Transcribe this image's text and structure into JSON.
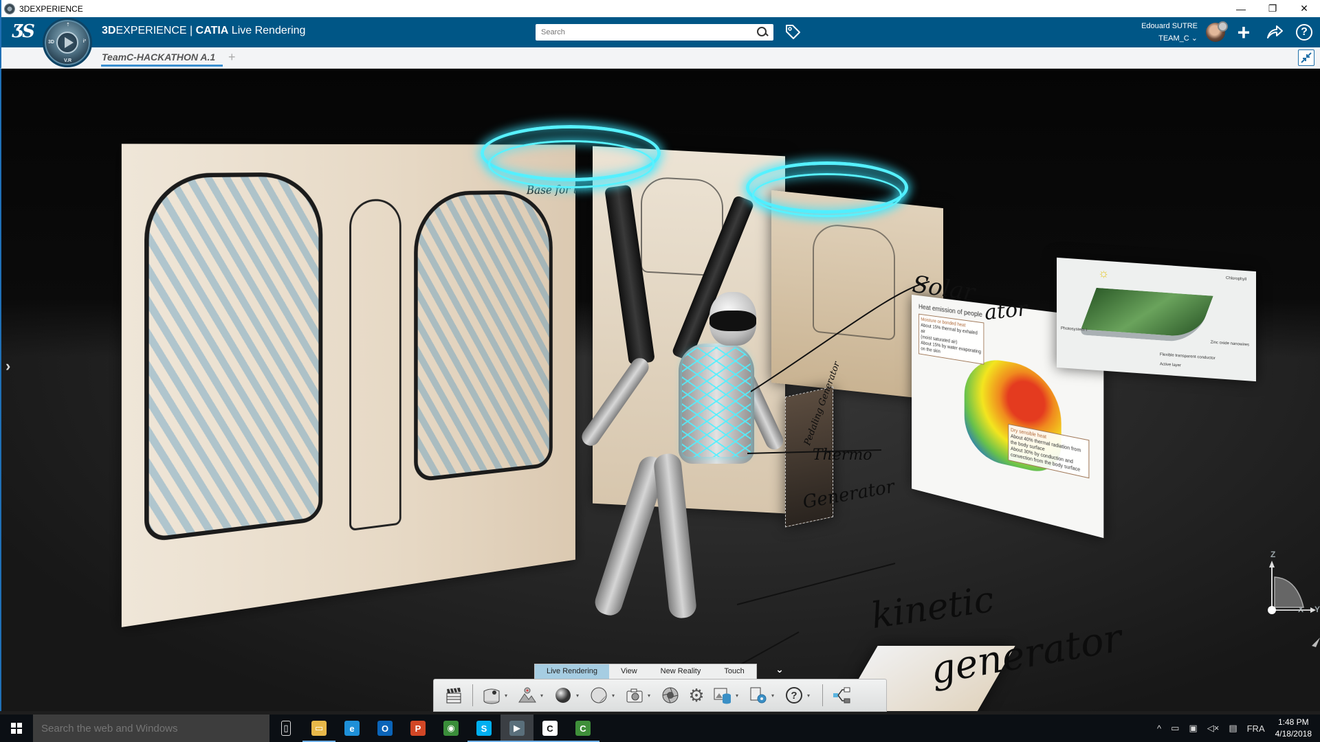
{
  "window": {
    "title": "3DEXPERIENCE",
    "controls": {
      "minimize": "—",
      "restore": "❐",
      "close": "✕"
    }
  },
  "topbar": {
    "brand_bold": "3D",
    "brand_rest": "EXPERIENCE | ",
    "brand_app": "CATIA",
    "brand_suffix": " Live Rendering",
    "search": {
      "placeholder": "Search",
      "value": ""
    },
    "compass_labels": {
      "left": "3D",
      "right": "i³",
      "bottom": "V.R",
      "top": "⇡"
    },
    "user": {
      "name": "Edouard SUTRE",
      "team": "TEAM_C"
    },
    "icons": [
      "ds-logo-icon",
      "compass-icon",
      "search-icon",
      "tag-icon",
      "avatar",
      "plus-icon",
      "share-icon",
      "help-icon"
    ],
    "plus_label": "+",
    "help_label": "?"
  },
  "tabbar": {
    "tabs": [
      {
        "label": "TeamC-HACKATHON A.1",
        "active": true
      }
    ],
    "add_label": "+"
  },
  "viewport": {
    "side_arrow": "›",
    "scene_annotations": {
      "sketch_note": "Base for the Wi",
      "solar": "Solar",
      "solar2": "ator",
      "pedal": "Pedaling Generator",
      "thermo": "Thermo",
      "generator": "Generator",
      "kinetic": "kinetic",
      "kinetic_gen": "generator"
    },
    "heat_panel": {
      "title": "Heat emission of people",
      "box1_head": "Moisture or bonded heat",
      "box1_line1": "About 15% thermal by exhaled air",
      "box1_line2": "(moist saturated air)",
      "box1_line3": "About 15% by water evaporating on the skin",
      "box2_head": "Dry sensible heat",
      "box2_line1": "About 40% thermal radiation from the body surface",
      "box2_line2": "About 30% by conduction and convection from the body surface"
    },
    "solar_panel": {
      "chlorophyll": "Chlorophyll",
      "photosystem": "Photosystem I",
      "nanowires": "Zinc oxide nanowires",
      "conductor": "Flexible transparent conductor",
      "active_layer": "Active layer"
    },
    "triad": {
      "z": "Z",
      "x": "X",
      "y": "Y"
    },
    "colors": {
      "glow": "#58f2ff",
      "background": "#262626"
    }
  },
  "action_bar": {
    "tabs": [
      {
        "label": "Live Rendering",
        "active": true
      },
      {
        "label": "View",
        "active": false
      },
      {
        "label": "New Reality",
        "active": false
      },
      {
        "label": "Touch",
        "active": false
      }
    ],
    "more_label": "⌄",
    "tools": [
      {
        "name": "clapperboard-icon",
        "glyph": "🎬",
        "dropdown": false
      },
      {
        "name": "environment-icon",
        "glyph": "☀",
        "dropdown": true
      },
      {
        "name": "light-source-icon",
        "glyph": "⛰",
        "dropdown": true
      },
      {
        "name": "material-sphere-icon",
        "glyph": "●",
        "dropdown": true
      },
      {
        "name": "sticker-icon",
        "glyph": "◐",
        "dropdown": true
      },
      {
        "name": "camera-icon",
        "glyph": "📷",
        "dropdown": true
      },
      {
        "name": "aperture-icon",
        "glyph": "◎",
        "dropdown": false
      },
      {
        "name": "settings-gear-icon",
        "glyph": "⚙",
        "dropdown": false
      },
      {
        "name": "image-database-icon",
        "glyph": "🗄",
        "dropdown": true
      },
      {
        "name": "render-settings-icon",
        "glyph": "⚙",
        "dropdown": true
      },
      {
        "name": "help-icon",
        "glyph": "?",
        "dropdown": true
      },
      {
        "name": "tree-structure-icon",
        "glyph": "⊶",
        "dropdown": false
      }
    ],
    "dropdown_glyph": "▾"
  },
  "taskbar": {
    "search_placeholder": "Search the web and Windows",
    "apps": [
      {
        "name": "task-view-icon",
        "label": "▯",
        "color": "transparent"
      },
      {
        "name": "file-explorer-icon",
        "label": "▭",
        "color": "#e8b84a"
      },
      {
        "name": "internet-explorer-icon",
        "label": "e",
        "color": "#1e90d8"
      },
      {
        "name": "outlook-icon",
        "label": "O",
        "color": "#0a64b8"
      },
      {
        "name": "powerpoint-icon",
        "label": "P",
        "color": "#d24726"
      },
      {
        "name": "chrome-icon",
        "label": "◉",
        "color": "#3a8d3a"
      },
      {
        "name": "skype-icon",
        "label": "S",
        "color": "#00aff0"
      },
      {
        "name": "3dexperience-icon",
        "label": "▶",
        "color": "#5a6f7b"
      },
      {
        "name": "catia-c-icon",
        "label": "C",
        "color": "#ffffff"
      },
      {
        "name": "catia-green-icon",
        "label": "C",
        "color": "#3f8f3a"
      }
    ],
    "tray": {
      "chevron": "^",
      "battery": "🔋",
      "network": "🖧",
      "volume": "🔇",
      "notifications": "🗨",
      "language": "FRA",
      "time": "1:48 PM",
      "date": "4/18/2018"
    }
  }
}
